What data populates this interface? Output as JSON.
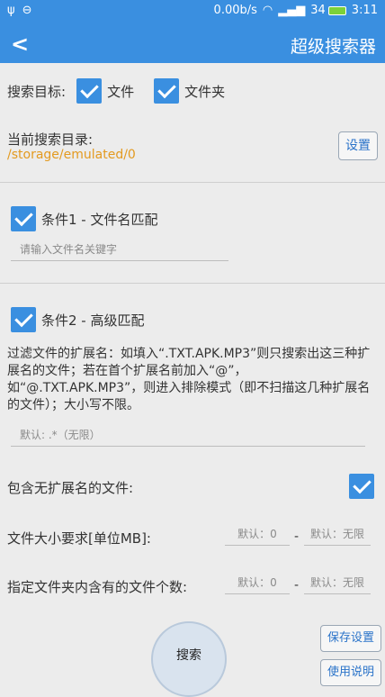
{
  "status": {
    "speed": "0.00b/s",
    "battery": "34",
    "time": "3:11"
  },
  "appbar": {
    "title": "超级搜索器"
  },
  "target": {
    "label": "搜索目标:",
    "file": "文件",
    "folder": "文件夹"
  },
  "dir": {
    "label": "当前搜索目录:",
    "path": "/storage/emulated/0",
    "settings_btn": "设置"
  },
  "cond1": {
    "label": "条件1 - 文件名匹配",
    "placeholder": "请输入文件名关键字"
  },
  "cond2": {
    "label": "条件2 - 高级匹配",
    "desc": "过滤文件的扩展名：如填入“.TXT.APK.MP3”则只搜索出这三种扩展名的文件；若在首个扩展名前加入“@”，如“@.TXT.APK.MP3”，则进入排除模式（即不扫描这几种扩展名的文件）；大小写不限。",
    "ext_placeholder": "默认: .*（无限）",
    "noext_label": "包含无扩展名的文件:",
    "size_label": "文件大小要求[单位MB]:",
    "size_min": "默认：0",
    "size_max": "默认：无限",
    "count_label": "指定文件夹内含有的文件个数:",
    "count_min": "默认：0",
    "count_max": "默认：无限",
    "dash": "-"
  },
  "bottom": {
    "search_btn": "搜索",
    "save_btn": "保存设置",
    "help_btn": "使用说明"
  }
}
